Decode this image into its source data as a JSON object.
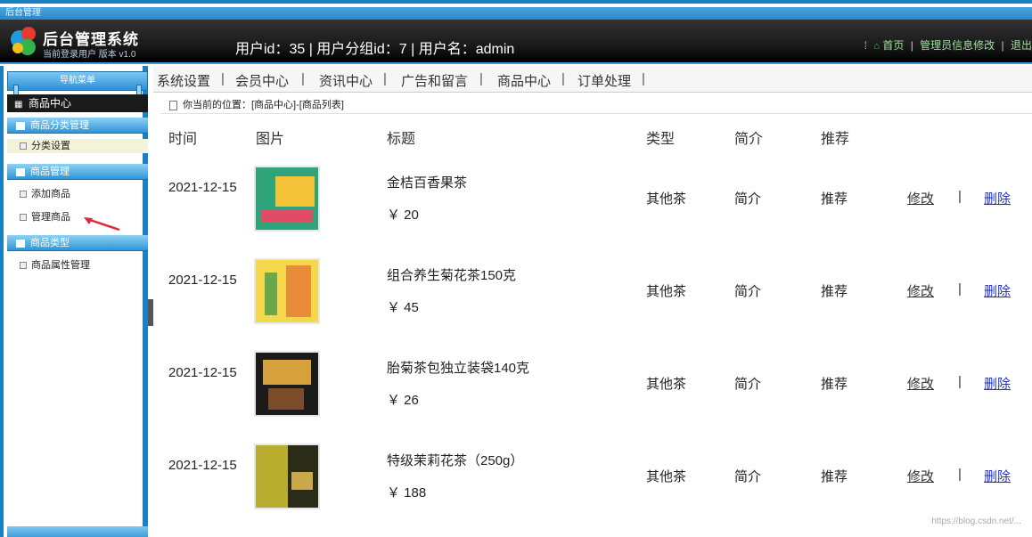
{
  "window": {
    "title_strip": "后台管理"
  },
  "header": {
    "system_title": "后台管理系统",
    "system_sub": "当前登录用户 版本 v1.0",
    "user_info": "用户id：35 | 用户分组id：7 | 用户名：admin",
    "home_link": "首页",
    "right_link": "管理员信息修改",
    "right_extra": "退出"
  },
  "sidebar": {
    "top_label": "导航菜单",
    "active_menu": "商品中心",
    "groups": [
      {
        "title": "商品分类管理",
        "items": [
          {
            "label": "分类设置"
          }
        ]
      },
      {
        "title": "商品管理",
        "items": [
          {
            "label": "添加商品"
          },
          {
            "label": "管理商品"
          }
        ]
      },
      {
        "title": "商品类型",
        "items": [
          {
            "label": "商品属性管理"
          }
        ]
      }
    ]
  },
  "tabs": [
    {
      "label": "系统设置"
    },
    {
      "label": "会员中心"
    },
    {
      "label": "资讯中心"
    },
    {
      "label": "广告和留言"
    },
    {
      "label": "商品中心"
    },
    {
      "label": "订单处理"
    }
  ],
  "breadcrumb": "你当前的位置：[商品中心]-[商品列表]",
  "table": {
    "headers": [
      "时间",
      "图片",
      "标题",
      "类型",
      "简介",
      "推荐"
    ],
    "rows": [
      {
        "date": "2021-12-15",
        "title": "金桔百香果茶",
        "price": "￥ 20",
        "type": "其他茶",
        "brief": "简介",
        "recommend": "推荐",
        "edit": "修改",
        "pipe": "|",
        "delete": "删除",
        "thumb_colors": [
          "#2fa37a",
          "#f3c237",
          "#e14b63"
        ]
      },
      {
        "date": "2021-12-15",
        "title": "组合养生菊花茶150克",
        "price": "￥ 45",
        "type": "其他茶",
        "brief": "简介",
        "recommend": "推荐",
        "edit": "修改",
        "pipe": "|",
        "delete": "删除",
        "thumb_colors": [
          "#f5d84a",
          "#6aa84f",
          "#e88c3c"
        ]
      },
      {
        "date": "2021-12-15",
        "title": "胎菊茶包独立装袋140克",
        "price": "￥ 26",
        "type": "其他茶",
        "brief": "简介",
        "recommend": "推荐",
        "edit": "修改",
        "pipe": "|",
        "delete": "删除",
        "thumb_colors": [
          "#1b1b1b",
          "#d7a23d",
          "#7c4b2a"
        ]
      },
      {
        "date": "2021-12-15",
        "title": "特级茉莉花茶（250g）",
        "price": "￥ 188",
        "type": "其他茶",
        "brief": "简介",
        "recommend": "推荐",
        "edit": "修改",
        "pipe": "|",
        "delete": "删除",
        "thumb_colors": [
          "#b8ad2e",
          "#2b2b1a",
          "#caa94a"
        ]
      }
    ]
  },
  "watermark": "https://blog.csdn.net/..."
}
